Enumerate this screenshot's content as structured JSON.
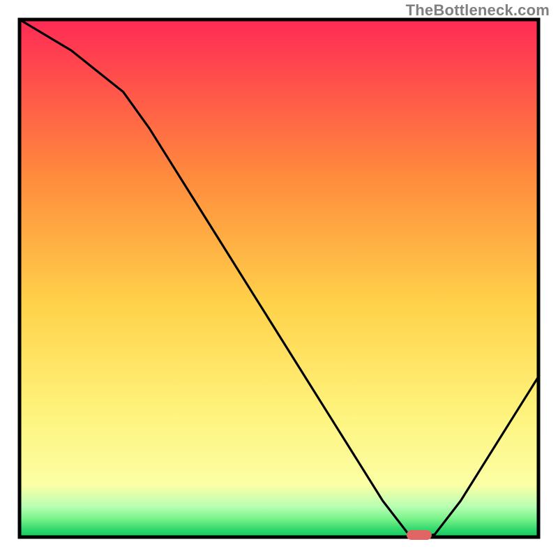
{
  "watermark": "TheBottleneck.com",
  "colors": {
    "axis_stroke": "#000000",
    "curve_stroke": "#000000",
    "marker_fill": "#e06666",
    "gradient_top": "#ff2a55",
    "gradient_mid1": "#ff8a3d",
    "gradient_mid2": "#ffd24a",
    "gradient_mid3": "#fff27a",
    "gradient_mid4": "#fbffa5",
    "gradient_green1": "#b9ffb3",
    "gradient_green2": "#79f28a",
    "gradient_green3": "#32d86e",
    "gradient_green4": "#0cc95c"
  },
  "chart_data": {
    "type": "line",
    "title": "",
    "xlabel": "",
    "ylabel": "",
    "xlim": [
      0,
      100
    ],
    "ylim": [
      0,
      100
    ],
    "categories_note": "No numeric axis labels are shown; values are estimated from curve geometry (0–100 scale on each axis).",
    "x": [
      0,
      5,
      10,
      15,
      20,
      25,
      30,
      35,
      40,
      45,
      50,
      55,
      60,
      65,
      70,
      75,
      77,
      80,
      85,
      90,
      95,
      100
    ],
    "y": [
      100,
      97,
      94,
      90,
      86,
      79,
      71,
      63,
      55,
      47,
      39,
      31,
      23,
      15,
      7,
      0.5,
      0,
      0.5,
      7,
      15,
      23,
      31
    ],
    "minimum_marker": {
      "x": 77,
      "y": 0
    },
    "legend": []
  }
}
